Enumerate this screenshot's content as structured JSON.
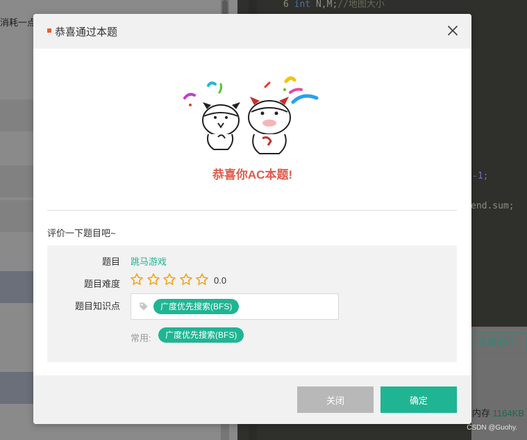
{
  "background": {
    "left_fragment": "消耗一点",
    "code_line_number": "6",
    "code_keyword": "int",
    "code_vars": " N,M;",
    "code_comment": "//地图大小",
    "code_fragment_1": "-1;",
    "code_fragment_2": "end.sum;",
    "self_run_label": "> 自测运行",
    "memory_label": "内存",
    "memory_value": "1164KB",
    "watermark": "CSDN @Guohy."
  },
  "modal": {
    "title": "恭喜通过本题",
    "success_message": "恭喜你AC本题!",
    "rate_prompt": "评价一下题目吧~",
    "form": {
      "problem_label": "题目",
      "problem_name": "跳马游戏",
      "difficulty_label": "题目难度",
      "difficulty_rating": 0,
      "difficulty_max": 5,
      "difficulty_value": "0.0",
      "knowledge_label": "题目知识点",
      "selected_tags": [
        "广度优先搜索(BFS)"
      ],
      "common_label": "常用:",
      "common_tags": [
        "广度优先搜索(BFS)"
      ]
    },
    "buttons": {
      "close": "关闭",
      "confirm": "确定"
    }
  },
  "colors": {
    "accent": "#1fb593",
    "success_text": "#e15b4c",
    "title_marker": "#ee5b2d",
    "star_outline": "#f5a623",
    "close_button_bg": "#b8b8b8"
  },
  "icons": [
    "close-icon",
    "star-icon",
    "tag-icon",
    "cartoon-celebration-image"
  ]
}
